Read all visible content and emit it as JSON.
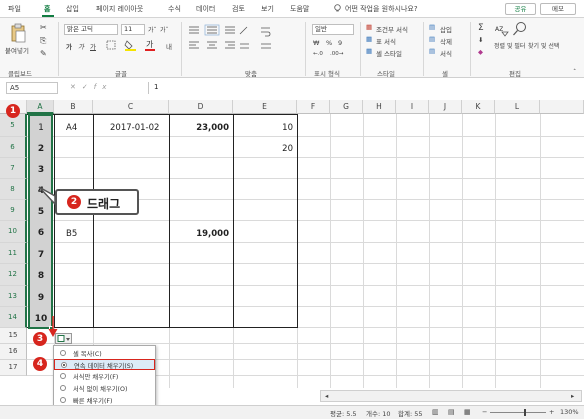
{
  "tabs": {
    "items": [
      "파일",
      "홈",
      "삽입",
      "페이지 레이아웃",
      "수식",
      "데이터",
      "검토",
      "보기",
      "도움말"
    ],
    "search": "어떤 작업을 원하시나요?",
    "share": "공유",
    "memo": "메모"
  },
  "ribbon": {
    "clipboard": {
      "paste": "붙여넣기",
      "group": "클립보드"
    },
    "font": {
      "name": "맑은 고딕",
      "size": "11",
      "bold": "가",
      "italic": "가",
      "underline": "가",
      "group": "글꼴"
    },
    "align": {
      "group": "맞춤"
    },
    "number": {
      "format": "일반",
      "percent": "%",
      "comma": "9",
      "group": "표시 형식"
    },
    "styles": {
      "cond": "조건부 서식",
      "table": "표 서식",
      "cell": "셀 스타일",
      "group": "스타일"
    },
    "cells": {
      "insert": "삽입",
      "delete": "삭제",
      "format": "서식",
      "group": "셀"
    },
    "edit": {
      "sort": "정렬 및 필터",
      "find": "찾기 및 선택",
      "group": "편집"
    }
  },
  "formula_bar": {
    "name_box": "A5",
    "formula": "1",
    "fx": "fx"
  },
  "columns": [
    "A",
    "B",
    "C",
    "D",
    "E",
    "F",
    "G",
    "H",
    "I",
    "J",
    "K",
    "L"
  ],
  "rows": [
    "5",
    "6",
    "7",
    "8",
    "9",
    "10",
    "11",
    "12",
    "13",
    "14",
    "15",
    "16",
    "17"
  ],
  "cells": {
    "a": [
      "1",
      "2",
      "3",
      "4",
      "5",
      "6",
      "7",
      "8",
      "9",
      "10"
    ],
    "b5": "A4",
    "c5": "2017-01-02",
    "d5": "23,000",
    "e5": "10",
    "e6": "20",
    "b10": "B5",
    "d10": "19,000"
  },
  "annotations": {
    "step1": "1",
    "step2": "2",
    "drag": "드래그",
    "step3": "3",
    "step4": "4"
  },
  "autofill_menu": {
    "items": [
      "셀 복사(C)",
      "연속 데이터 채우기(S)",
      "서식만 채우기(F)",
      "서식 없이 채우기(O)",
      "빠른 채우기(F)"
    ],
    "selected_index": 1
  },
  "status": {
    "average": "평균: 5.5",
    "count": "개수: 10",
    "sum": "합계: 55",
    "zoom": "130%"
  },
  "colors": {
    "accent": "#217346",
    "badge": "#d7261e"
  }
}
